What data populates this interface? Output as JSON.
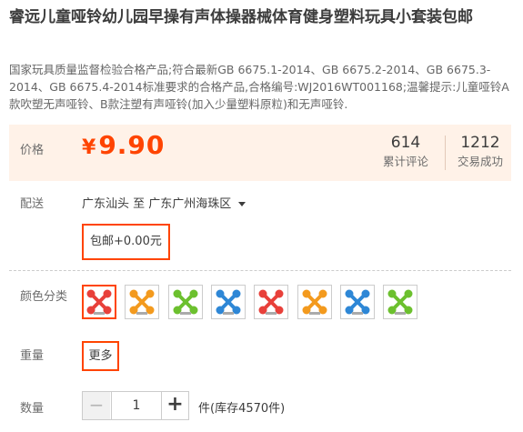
{
  "product": {
    "title": "睿远儿童哑铃幼儿园早操有声体操器械体育健身塑料玩具小套装包邮",
    "subtitle": "国家玩具质量监督检验合格产品;符合最新GB 6675.1-2014、GB 6675.2-2014、GB 6675.3-2014、GB 6675.4-2014标准要求的合格产品,合格编号:WJ2016WT001168;温馨提示:儿童哑铃A款吹塑无声哑铃、B款注塑有声哑铃(加入少量塑料原粒)和无声哑铃."
  },
  "price": {
    "label": "价格",
    "currency": "¥",
    "value": "9.90",
    "color": "#ff4400"
  },
  "stats": {
    "reviews_count": "614",
    "reviews_label": "累计评论",
    "sold_count": "1212",
    "sold_label": "交易成功"
  },
  "shipping": {
    "label": "配送",
    "route": "广东汕头 至  广东广州海珠区",
    "fee": "包邮+0.00元"
  },
  "color_options": {
    "label": "颜色分类",
    "selected_index": 0,
    "items": [
      {
        "color": "#e8403a",
        "icon": "dumbbell-icon"
      },
      {
        "color": "#f39a1e",
        "icon": "dumbbell-icon"
      },
      {
        "color": "#6cc02e",
        "icon": "dumbbell-icon"
      },
      {
        "color": "#2e87d6",
        "icon": "dumbbell-icon"
      },
      {
        "color": "#e8403a",
        "icon": "dumbbell-icon"
      },
      {
        "color": "#f39a1e",
        "icon": "dumbbell-icon"
      },
      {
        "color": "#2e87d6",
        "icon": "dumbbell-icon"
      },
      {
        "color": "#6cc02e",
        "icon": "dumbbell-icon"
      }
    ]
  },
  "weight": {
    "label": "重量",
    "option": "更多"
  },
  "quantity": {
    "label": "数量",
    "value": "1",
    "minus": "−",
    "plus": "+",
    "stock": "件(库存4570件)"
  }
}
